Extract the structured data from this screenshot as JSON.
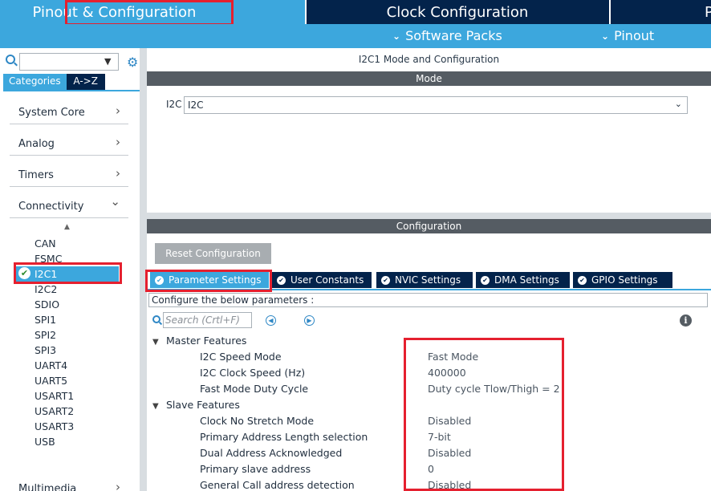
{
  "top_tabs": {
    "pinout": "Pinout & Configuration",
    "clock": "Clock Configuration",
    "project": "P"
  },
  "subbar": {
    "software_packs": "Software Packs",
    "pinout": "Pinout"
  },
  "left": {
    "search_value": "",
    "tabs": [
      "Categories",
      "A->Z"
    ],
    "categories": [
      {
        "label": "System Core",
        "arrow": "›"
      },
      {
        "label": "Analog",
        "arrow": "›"
      },
      {
        "label": "Timers",
        "arrow": "›"
      },
      {
        "label": "Connectivity",
        "arrow": "⌄"
      },
      {
        "label": "Multimedia",
        "arrow": "›"
      }
    ],
    "peripherals": [
      "CAN",
      "FSMC",
      "I2C1",
      "I2C2",
      "SDIO",
      "SPI1",
      "SPI2",
      "SPI3",
      "UART4",
      "UART5",
      "USART1",
      "USART2",
      "USART3",
      "USB"
    ],
    "selected": "I2C1"
  },
  "right": {
    "title": "I2C1 Mode and Configuration",
    "mode_header": "Mode",
    "mode_label": "I2C",
    "mode_value": "I2C",
    "config_header": "Configuration",
    "reset_button": "Reset Configuration",
    "tabs": [
      "Parameter Settings",
      "User Constants",
      "NVIC Settings",
      "DMA Settings",
      "GPIO Settings"
    ],
    "hint": "Configure the below parameters :",
    "search_placeholder": "Search (Crtl+F)",
    "groups": [
      {
        "name": "Master Features",
        "params": [
          {
            "name": "I2C Speed Mode",
            "value": "Fast Mode"
          },
          {
            "name": "I2C Clock Speed (Hz)",
            "value": "400000"
          },
          {
            "name": "Fast Mode Duty Cycle",
            "value": "Duty cycle Tlow/Thigh = 2"
          }
        ]
      },
      {
        "name": "Slave Features",
        "params": [
          {
            "name": "Clock No Stretch Mode",
            "value": "Disabled"
          },
          {
            "name": "Primary Address Length selection",
            "value": "7-bit"
          },
          {
            "name": "Dual Address Acknowledged",
            "value": "Disabled"
          },
          {
            "name": "Primary slave address",
            "value": "0"
          },
          {
            "name": "General Call address detection",
            "value": "Disabled"
          }
        ]
      }
    ]
  },
  "colors": {
    "accent": "#3ca7dd",
    "navy": "#03234b",
    "highlight": "#e5202f",
    "section_bar": "#555c63"
  }
}
